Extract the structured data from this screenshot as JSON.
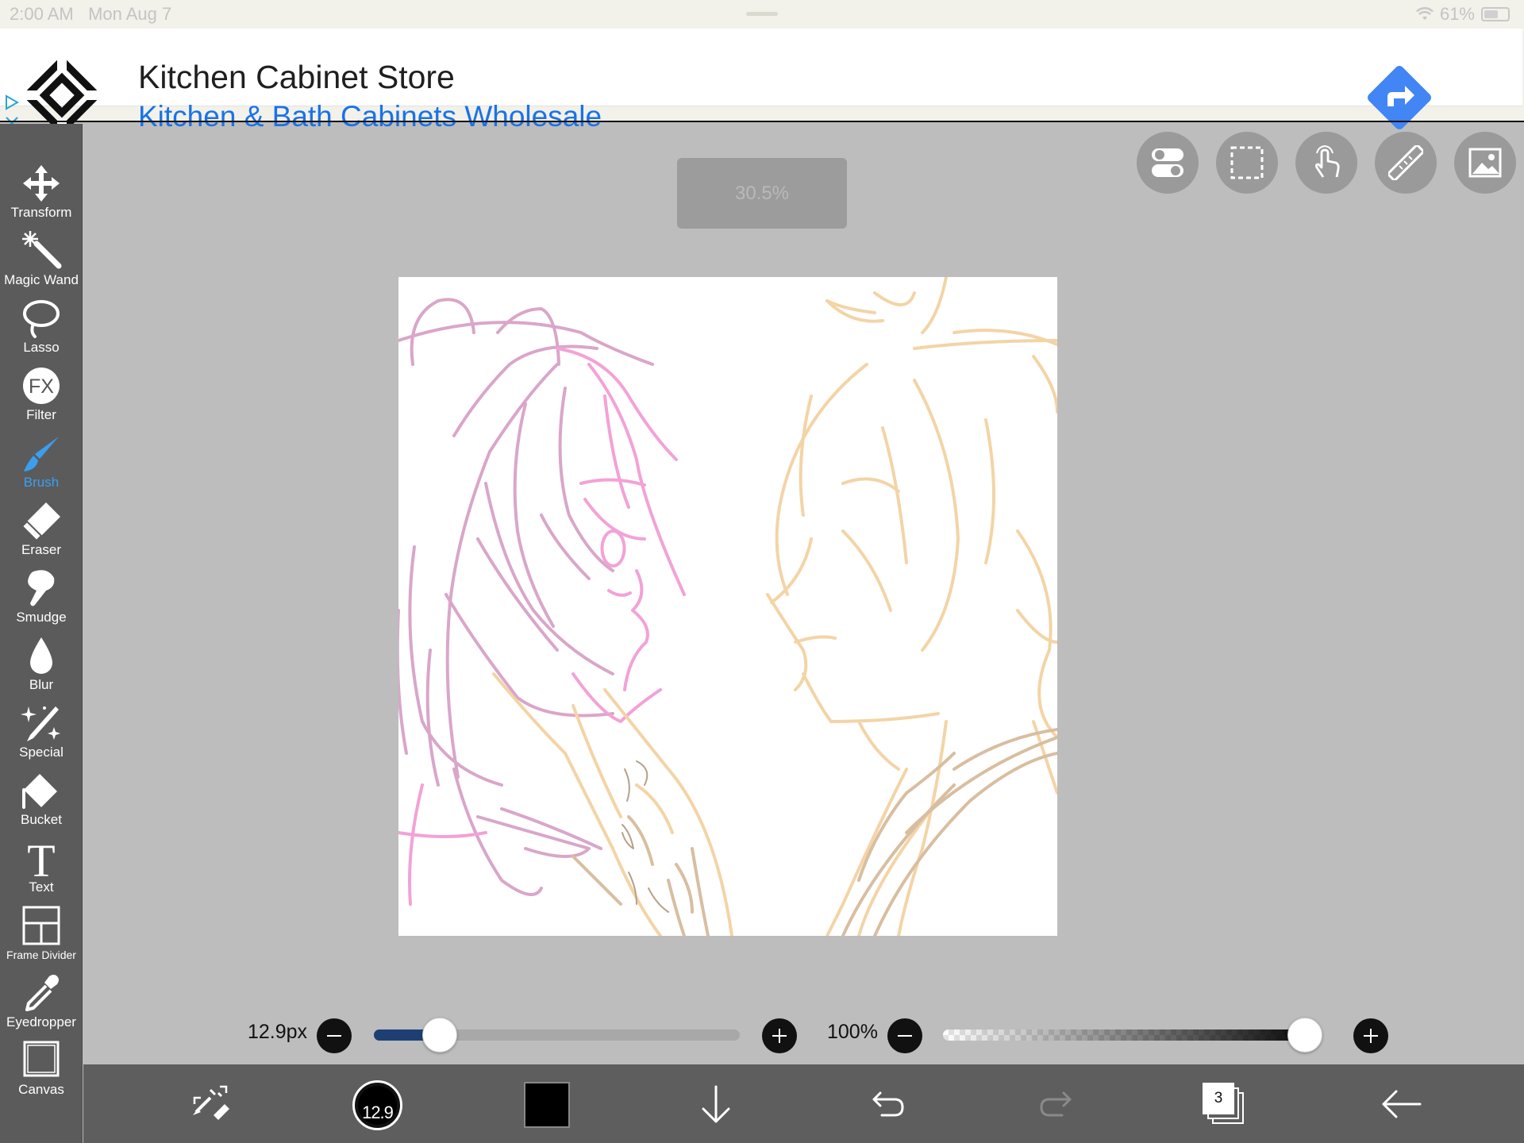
{
  "status_bar": {
    "time": "2:00 AM",
    "date": "Mon Aug 7",
    "battery": "61%",
    "battery_level": 0.61
  },
  "ad": {
    "title": "Kitchen Cabinet Store",
    "subtitle": "Kitchen & Bath Cabinets Wholesale",
    "accent_color": "#4285f4",
    "subtitle_color": "#1a73e8"
  },
  "zoom_level": "30.5%",
  "tools": [
    {
      "label": "Transform",
      "icon": "move-arrows-icon"
    },
    {
      "label": "Magic Wand",
      "icon": "magic-wand-icon"
    },
    {
      "label": "Lasso",
      "icon": "lasso-icon"
    },
    {
      "label": "Filter",
      "icon": "fx-icon",
      "glyph": "FX"
    },
    {
      "label": "Brush",
      "icon": "brush-icon",
      "active": true
    },
    {
      "label": "Eraser",
      "icon": "eraser-icon"
    },
    {
      "label": "Smudge",
      "icon": "smudge-icon"
    },
    {
      "label": "Blur",
      "icon": "droplet-icon"
    },
    {
      "label": "Special",
      "icon": "sparkle-pen-icon"
    },
    {
      "label": "Bucket",
      "icon": "bucket-icon"
    },
    {
      "label": "Text",
      "icon": "text-icon",
      "glyph": "T"
    },
    {
      "label": "Frame Divider",
      "icon": "frame-divider-icon"
    },
    {
      "label": "Eyedropper",
      "icon": "eyedropper-icon"
    },
    {
      "label": "Canvas",
      "icon": "canvas-icon"
    }
  ],
  "top_buttons": [
    "toggle-icon",
    "selection-icon",
    "touch-icon",
    "ruler-icon",
    "image-icon"
  ],
  "brush": {
    "size_label": "12.9px",
    "size_fraction": 0.18,
    "opacity_label": "100%",
    "opacity_fraction": 1.0,
    "size_badge": "12.9",
    "color": "#000000"
  },
  "layers_count": "3",
  "colors": {
    "active_tool": "#3a9ff0",
    "toolbar_bg": "#5b5b5b",
    "workspace_bg": "#bdbdbd",
    "slider_fill": "#1e3f73"
  }
}
